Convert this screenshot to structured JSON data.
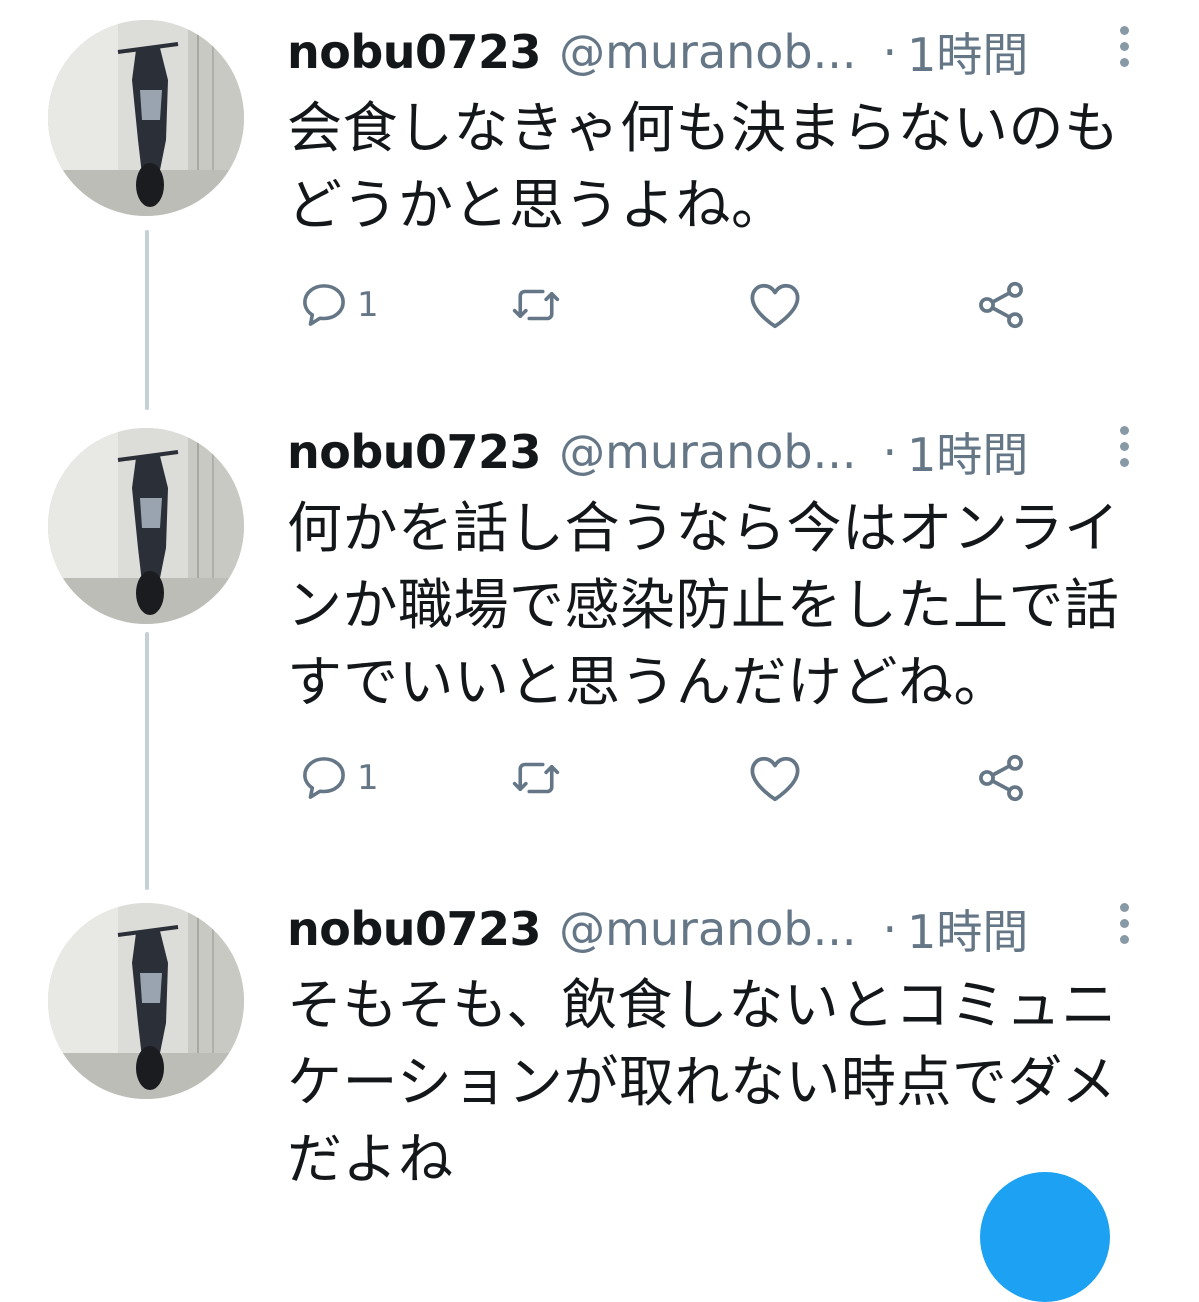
{
  "tweets": [
    {
      "name": "nobu0723",
      "handle": "@muranob...",
      "separator": "·",
      "time": "1時間",
      "text": "会食しなきゃ何も決まらないのもどうかと思うよね。",
      "reply_count": "1",
      "retweet_count": "",
      "like_count": ""
    },
    {
      "name": "nobu0723",
      "handle": "@muranob...",
      "separator": "·",
      "time": "1時間",
      "text": "何かを話し合うなら今はオンラインか職場で感染防止をした上で話すでいいと思うんだけどね。",
      "reply_count": "1",
      "retweet_count": "",
      "like_count": ""
    },
    {
      "name": "nobu0723",
      "handle": "@muranob...",
      "separator": "·",
      "time": "1時間",
      "text": "そもそも、飲食しないとコミュニケーションが取れない時点でダメだよね",
      "reply_count": "",
      "retweet_count": "",
      "like_count": ""
    }
  ],
  "icons": {
    "reply": "reply-icon",
    "retweet": "retweet-icon",
    "like": "heart-icon",
    "share": "share-icon",
    "more": "more-vertical-icon"
  },
  "colors": {
    "text": "#14171a",
    "secondary": "#657786",
    "thread_line": "#c4cfd6",
    "accent": "#1da1f2"
  }
}
